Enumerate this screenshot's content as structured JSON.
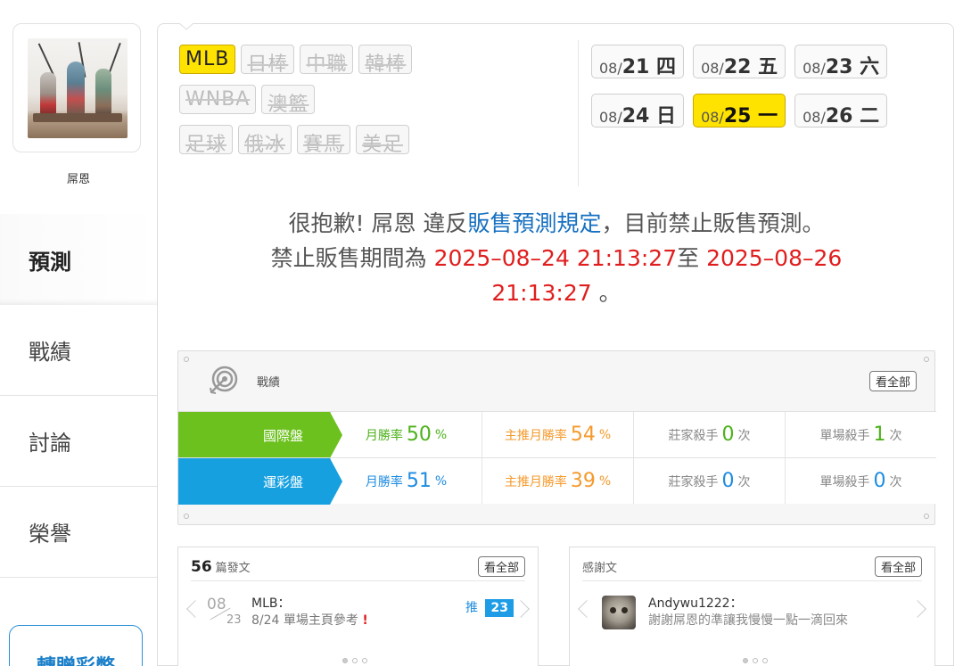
{
  "profile": {
    "name": "屌恩"
  },
  "sidebar": {
    "items": [
      {
        "label": "預測",
        "active": true
      },
      {
        "label": "戰績",
        "active": false
      },
      {
        "label": "討論",
        "active": false
      },
      {
        "label": "榮譽",
        "active": false
      }
    ],
    "bottom_button": "轉贈彩幣"
  },
  "sports": {
    "row1": [
      {
        "label": "MLB",
        "active": true
      },
      {
        "label": "日棒",
        "active": false
      },
      {
        "label": "中職",
        "active": false
      },
      {
        "label": "韓棒",
        "active": false
      }
    ],
    "row2": [
      {
        "label": "WNBA",
        "active": false
      },
      {
        "label": "澳籃",
        "active": false
      }
    ],
    "row3": [
      {
        "label": "足球",
        "active": false
      },
      {
        "label": "俄冰",
        "active": false
      },
      {
        "label": "賽馬",
        "active": false
      },
      {
        "label": "美足",
        "active": false
      }
    ]
  },
  "dates": {
    "row1": [
      {
        "month": "08/",
        "day": "21",
        "weekday": "四",
        "active": false
      },
      {
        "month": "08/",
        "day": "22",
        "weekday": "五",
        "active": false
      },
      {
        "month": "08/",
        "day": "23",
        "weekday": "六",
        "active": false
      }
    ],
    "row2": [
      {
        "month": "08/",
        "day": "24",
        "weekday": "日",
        "active": false
      },
      {
        "month": "08/",
        "day": "25",
        "weekday": "一",
        "active": true
      },
      {
        "month": "08/",
        "day": "26",
        "weekday": "二",
        "active": false
      }
    ]
  },
  "notice": {
    "part1": "很抱歉! 屌恩 違反",
    "link": "販售預測規定",
    "part2": "，目前禁止販售預測。",
    "part3": "禁止販售期間為 ",
    "start": "2025–08–24 21:13:27",
    "part4": "至 ",
    "end_date": "2025–08–26",
    "end_time": "21:13:27",
    "part5": " 。"
  },
  "stats": {
    "title": "戰績",
    "view_all": "看全部",
    "rows": [
      {
        "label": "國際盤",
        "color": "#6cc11e",
        "monthly_win_label": "月勝率",
        "monthly_win": "50",
        "monthly_unit": "%",
        "main_monthly_label": "主推月勝率",
        "main_monthly": "54",
        "main_unit": "%",
        "banker_label": "莊家殺手",
        "banker": "0",
        "banker_unit": "次",
        "single_label": "單場殺手",
        "single": "1",
        "single_unit": "次"
      },
      {
        "label": "運彩盤",
        "color": "#16a0e0",
        "monthly_win_label": "月勝率",
        "monthly_win": "51",
        "monthly_unit": "%",
        "main_monthly_label": "主推月勝率",
        "main_monthly": "39",
        "main_unit": "%",
        "banker_label": "莊家殺手",
        "banker": "0",
        "banker_unit": "次",
        "single_label": "單場殺手",
        "single": "0",
        "single_unit": "次"
      }
    ]
  },
  "posts": {
    "count": "56",
    "label": "篇發文",
    "view_all": "看全部",
    "item": {
      "month": "08",
      "day": "23",
      "league": "MLB：",
      "text": "8/24 單場主頁參考",
      "mark": "!",
      "push_label": "推",
      "push_count": "23"
    }
  },
  "thanks": {
    "label": "感謝文",
    "view_all": "看全部",
    "item": {
      "user": "Andywu1222：",
      "text": "謝謝屌恩的準讓我慢慢一點一滴回來"
    }
  }
}
